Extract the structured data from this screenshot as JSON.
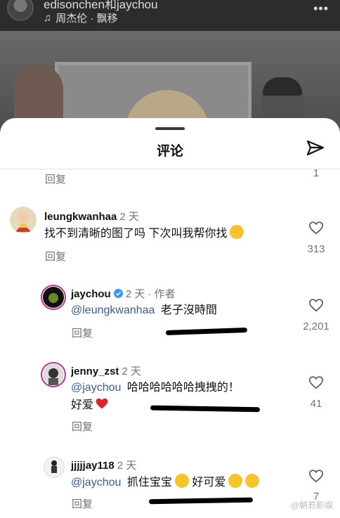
{
  "post": {
    "username": "edisonchen和jaychou",
    "music": "周杰伦 · 飘移",
    "more_icon": "more-icon"
  },
  "sheet": {
    "title": "评论"
  },
  "top_comment_tail": {
    "reply_label": "回复",
    "likes": "1"
  },
  "comments": [
    {
      "username": "leungkwanhaa",
      "time": "2 天",
      "text": "找不到清晰的图了吗 下次叫我帮你找",
      "emoji": "smirk-emoji",
      "reply_label": "回复",
      "likes": "313"
    },
    {
      "username": "jaychou",
      "verified": true,
      "time": "2 天",
      "author_tag": "· 作者",
      "mention": "@leungkwanhaa",
      "text": "老子沒時間",
      "reply_label": "回复",
      "likes": "2,201"
    },
    {
      "username": "jenny_zst",
      "time": "2 天",
      "mention": "@jaychou",
      "text": "哈哈哈哈哈哈拽拽的！",
      "text_line2": "好爱",
      "emoji": "red-heart-emoji",
      "reply_label": "回复",
      "likes": "41"
    },
    {
      "username": "jjjjjay118",
      "time": "2 天",
      "mention": "@jaychou",
      "text": "抓住宝宝",
      "text_after_emoji": "好可爱",
      "emoji": "heart-eyes-emoji",
      "emoji2": "rofl-emoji",
      "reply_label": "回复",
      "likes": "7"
    }
  ],
  "watermark": "@朝若影娱"
}
